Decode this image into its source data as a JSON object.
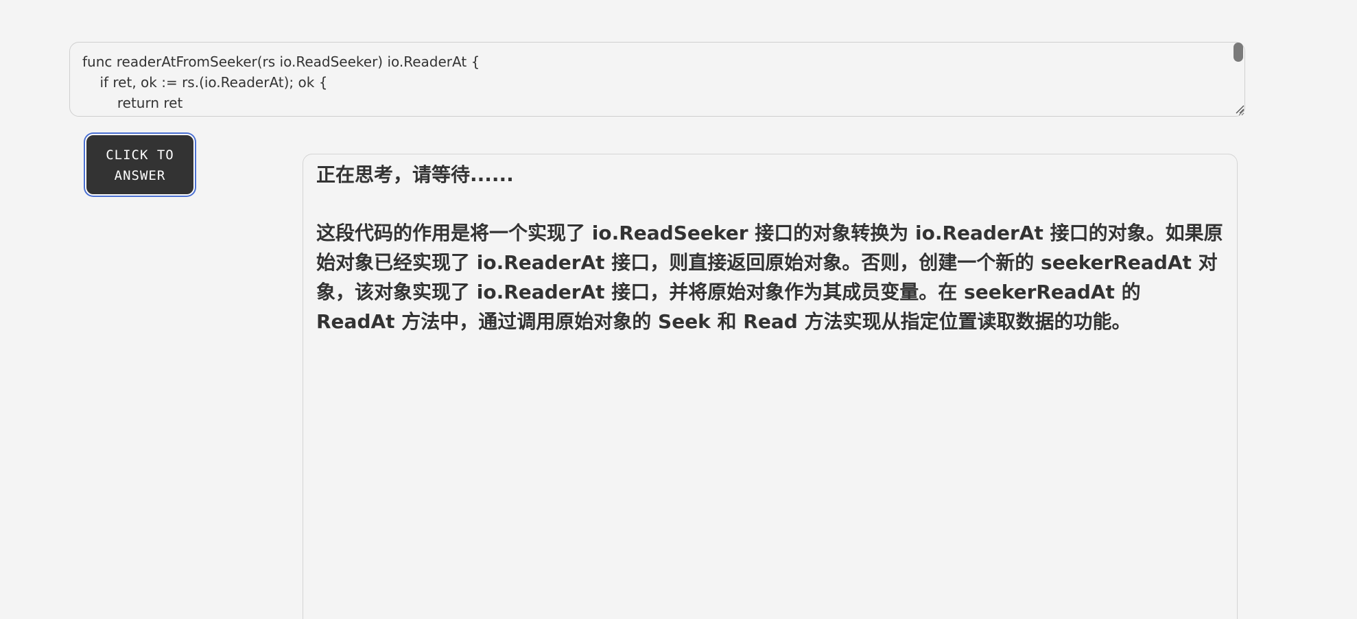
{
  "code_input": {
    "value": "func readerAtFromSeeker(rs io.ReadSeeker) io.ReaderAt {\n\tif ret, ok := rs.(io.ReaderAt); ok {\n\t\treturn ret\n\t}\n\treturn &seekerReadAt{rs}\n}"
  },
  "answer_button": {
    "label": "CLICK TO ANSWER"
  },
  "answer_panel": {
    "status": "正在思考，请等待......",
    "answer": "这段代码的作用是将一个实现了 io.ReadSeeker 接口的对象转换为 io.ReaderAt 接口的对象。如果原始对象已经实现了 io.ReaderAt 接口，则直接返回原始对象。否则，创建一个新的 seekerReadAt 对象，该对象实现了 io.ReaderAt 接口，并将原始对象作为其成员变量。在 seekerReadAt 的 ReadAt 方法中，通过调用原始对象的 Seek 和 Read 方法实现从指定位置读取数据的功能。"
  },
  "colors": {
    "background": "#f4f4f4",
    "text": "#333333",
    "button_bg": "#333333",
    "button_focus_ring": "#4a6fd1",
    "border": "#cfcfcf"
  }
}
